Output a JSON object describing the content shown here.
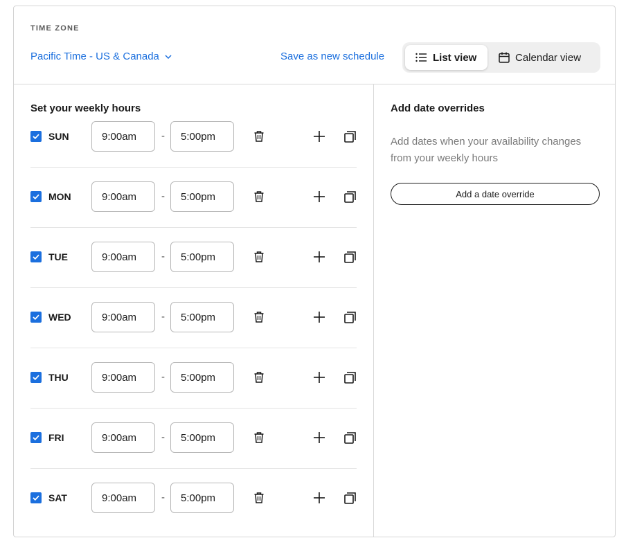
{
  "header": {
    "time_zone_label": "TIME ZONE",
    "time_zone_value": "Pacific Time - US & Canada",
    "save_link": "Save as new schedule",
    "views": {
      "list": "List view",
      "calendar": "Calendar view",
      "active": "list"
    }
  },
  "weekly": {
    "title": "Set your weekly hours",
    "days": [
      {
        "day": "SUN",
        "checked": true,
        "start": "9:00am",
        "end": "5:00pm"
      },
      {
        "day": "MON",
        "checked": true,
        "start": "9:00am",
        "end": "5:00pm"
      },
      {
        "day": "TUE",
        "checked": true,
        "start": "9:00am",
        "end": "5:00pm"
      },
      {
        "day": "WED",
        "checked": true,
        "start": "9:00am",
        "end": "5:00pm"
      },
      {
        "day": "THU",
        "checked": true,
        "start": "9:00am",
        "end": "5:00pm"
      },
      {
        "day": "FRI",
        "checked": true,
        "start": "9:00am",
        "end": "5:00pm"
      },
      {
        "day": "SAT",
        "checked": true,
        "start": "9:00am",
        "end": "5:00pm"
      }
    ],
    "separator": "-"
  },
  "overrides": {
    "title": "Add date overrides",
    "description": "Add dates when your availability changes from your weekly hours",
    "button": "Add a date override"
  },
  "colors": {
    "accent": "#1b6fde",
    "border": "#d4d4d4",
    "muted_text": "#7a7a7a"
  },
  "icons": [
    "chevron-down-icon",
    "list-icon",
    "calendar-icon",
    "check-icon",
    "trash-icon",
    "plus-icon",
    "copy-icon"
  ]
}
